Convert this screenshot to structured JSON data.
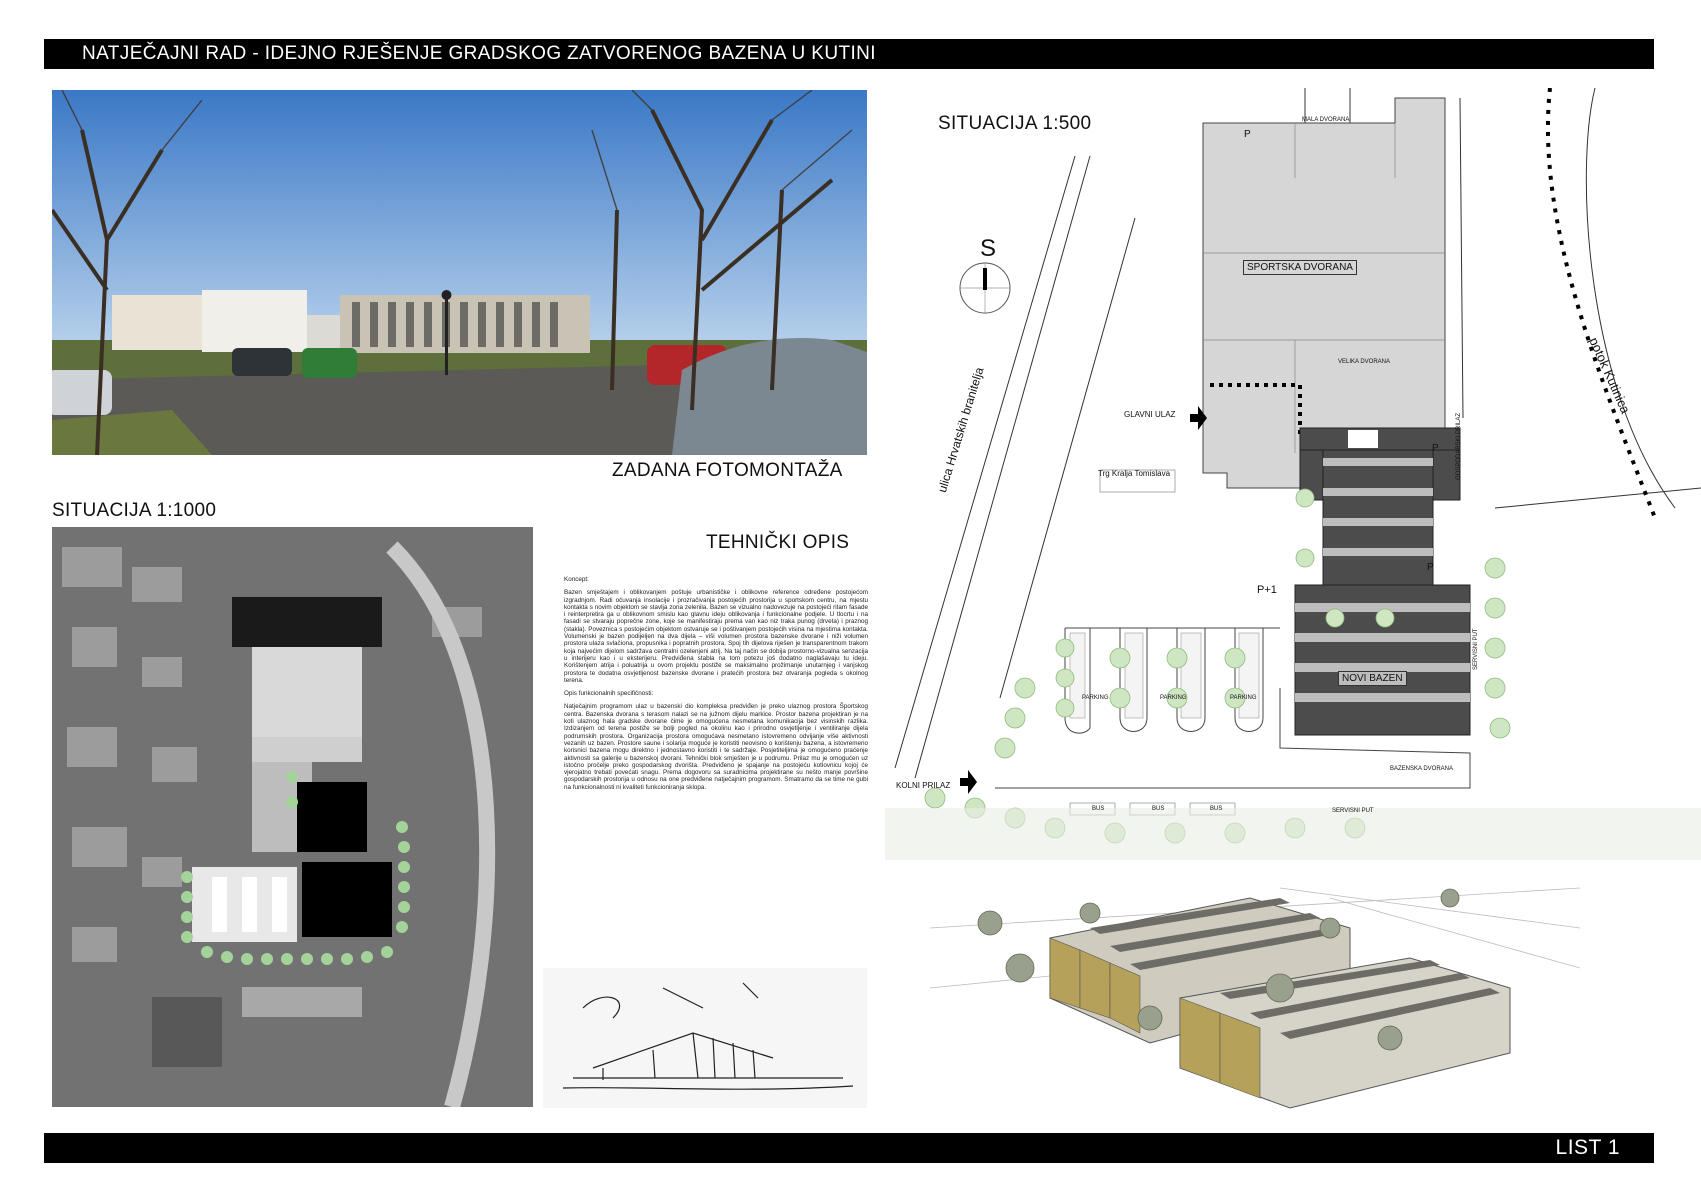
{
  "header": {
    "title": "NATJEČAJNI RAD - IDEJNO RJEŠENJE GRADSKOG ZATVORENOG BAZENA U KUTINI"
  },
  "footer": {
    "sheet": "LIST 1"
  },
  "photo_caption": "ZADANA FOTOMONTAŽA",
  "situation_1000": {
    "title": "SITUACIJA 1:1000"
  },
  "technical": {
    "title": "TEHNIČKI OPIS",
    "concept_heading": "Koncept:",
    "concept_text": "Bazen smještajem i oblikovanjem poštuje urbanističke i oblikovne reference određene postojećom izgradnjom. Radi očuvanja insolacije i prozračivanja postojećih prostorija u sportskom centru, na mjestu kontakta s novim objektom se stavlja zona zelenila. Bazen se vizualno nadovezuje na postojeći ritam fasade i reinterpretira ga u oblikovnom smislu kao glavnu ideju oblikovanja i funkcionalne podjele. U tlocrtu i na fasadi se stvaraju poprečne zone, koje se manifestiraju prema van kao niz traka punog (drveta) i praznog (stakla). Poveznica s postojećim objektom ostvaruje se i poštivanjem postojećih visina na mjestima kontakta. Volumenski je bazen podijeljen na dva dijela – viši volumen prostora bazenske dvorane i niži volumen prostora ulaza svlačiona, propusnika i popratnih prostora. Spoj tih dijelova riješen je transparentnom trakom koja najvećim dijelom sadržava centralni ozelenjeni atrij. Na taj način se dobija prostorno-vizualna senzacija u interijeru kao i u eksterijeru. Predviđena stabla na tom potezu još dodatno naglašavaju tu ideju. Korištenjem atrija i poluatrija u ovom projektu postiže se maksimalno prožimanje unutarnjeg i vanjskog prostora te dodatna osvjetljenost bazenske dvorane i pratećih prostora bez otvaranja pogleda s okolnog terena.",
    "functional_heading": "Opis funkcionalnih specifičnosti:",
    "functional_text": "Natječajnim programom ulaz u bazenski dio kompleksa predviđen je preko ulaznog prostora Športskog centra. Bazenska dvorana s terasom nalazi se na južnom dijelu markice. Prostor bazena projektiran je na koti ulaznog hala gradske dvorane čime je omogućena nesmetana komunikacija bez visinskih razlika. Izdizanjem od terena postiže se bolji pogled na okolinu kao i prirodno osvjetljenje i ventiliranje dijela podrumskih prostora. Organizacija prostora omogućava nesmetano istovremeno odvijanje više aktivnosti vezanih uz bazen. Prostore saune i solarija moguće je koristiti neovisno o korištenju bazena, a istovremeno korisnici bazena mogu direktno i jednostavno koristiti i te sadržaje. Posjetiteljima je omogućeno praćenje aktivnosti sa galerije u bazenskoj dvorani. Tehnički blok smješten je u podrumu. Prilaz mu je omogućen uz istočno pročelje preko gospodarskog dvorišta. Predviđeno je spajanje na postojeću kotlovnicu kojoj će vjerojatno trebati povećati snagu. Prema dogovoru sa suradnicima projektirane su nešto manje površine gospodarskih prostorija u odnosu na one predviđene natječajnim programom. Smatramo da se time ne gubi na funkcionalnosti ni kvaliteti funkcioniranja sklopa."
  },
  "situation_500": {
    "title": "SITUACIJA 1:500",
    "north": "S",
    "labels": {
      "sports_hall": "SPORTSKA DVORANA",
      "small_hall": "MALA DVORANA",
      "big_hall": "VELIKA DVORANA",
      "new_pool": "NOVI BAZEN",
      "pool_hall": "BAZENSKA DVORANA",
      "main_entrance": "GLAVNI ULAZ",
      "car_entrance": "KOLNI PRILAZ",
      "square": "Trg Kralja Tomislava",
      "street": "ulica Hrvatskih branitelja",
      "creek": "potok Kutinica",
      "service_road": "SERVISNI PUT",
      "service_road_v": "SERVISNI PUT",
      "farm_access": "GOSPODARSKI PRILAZ",
      "parking": "PARKING",
      "bus": "BUS",
      "p": "P",
      "p_plus_1": "P+1"
    }
  }
}
